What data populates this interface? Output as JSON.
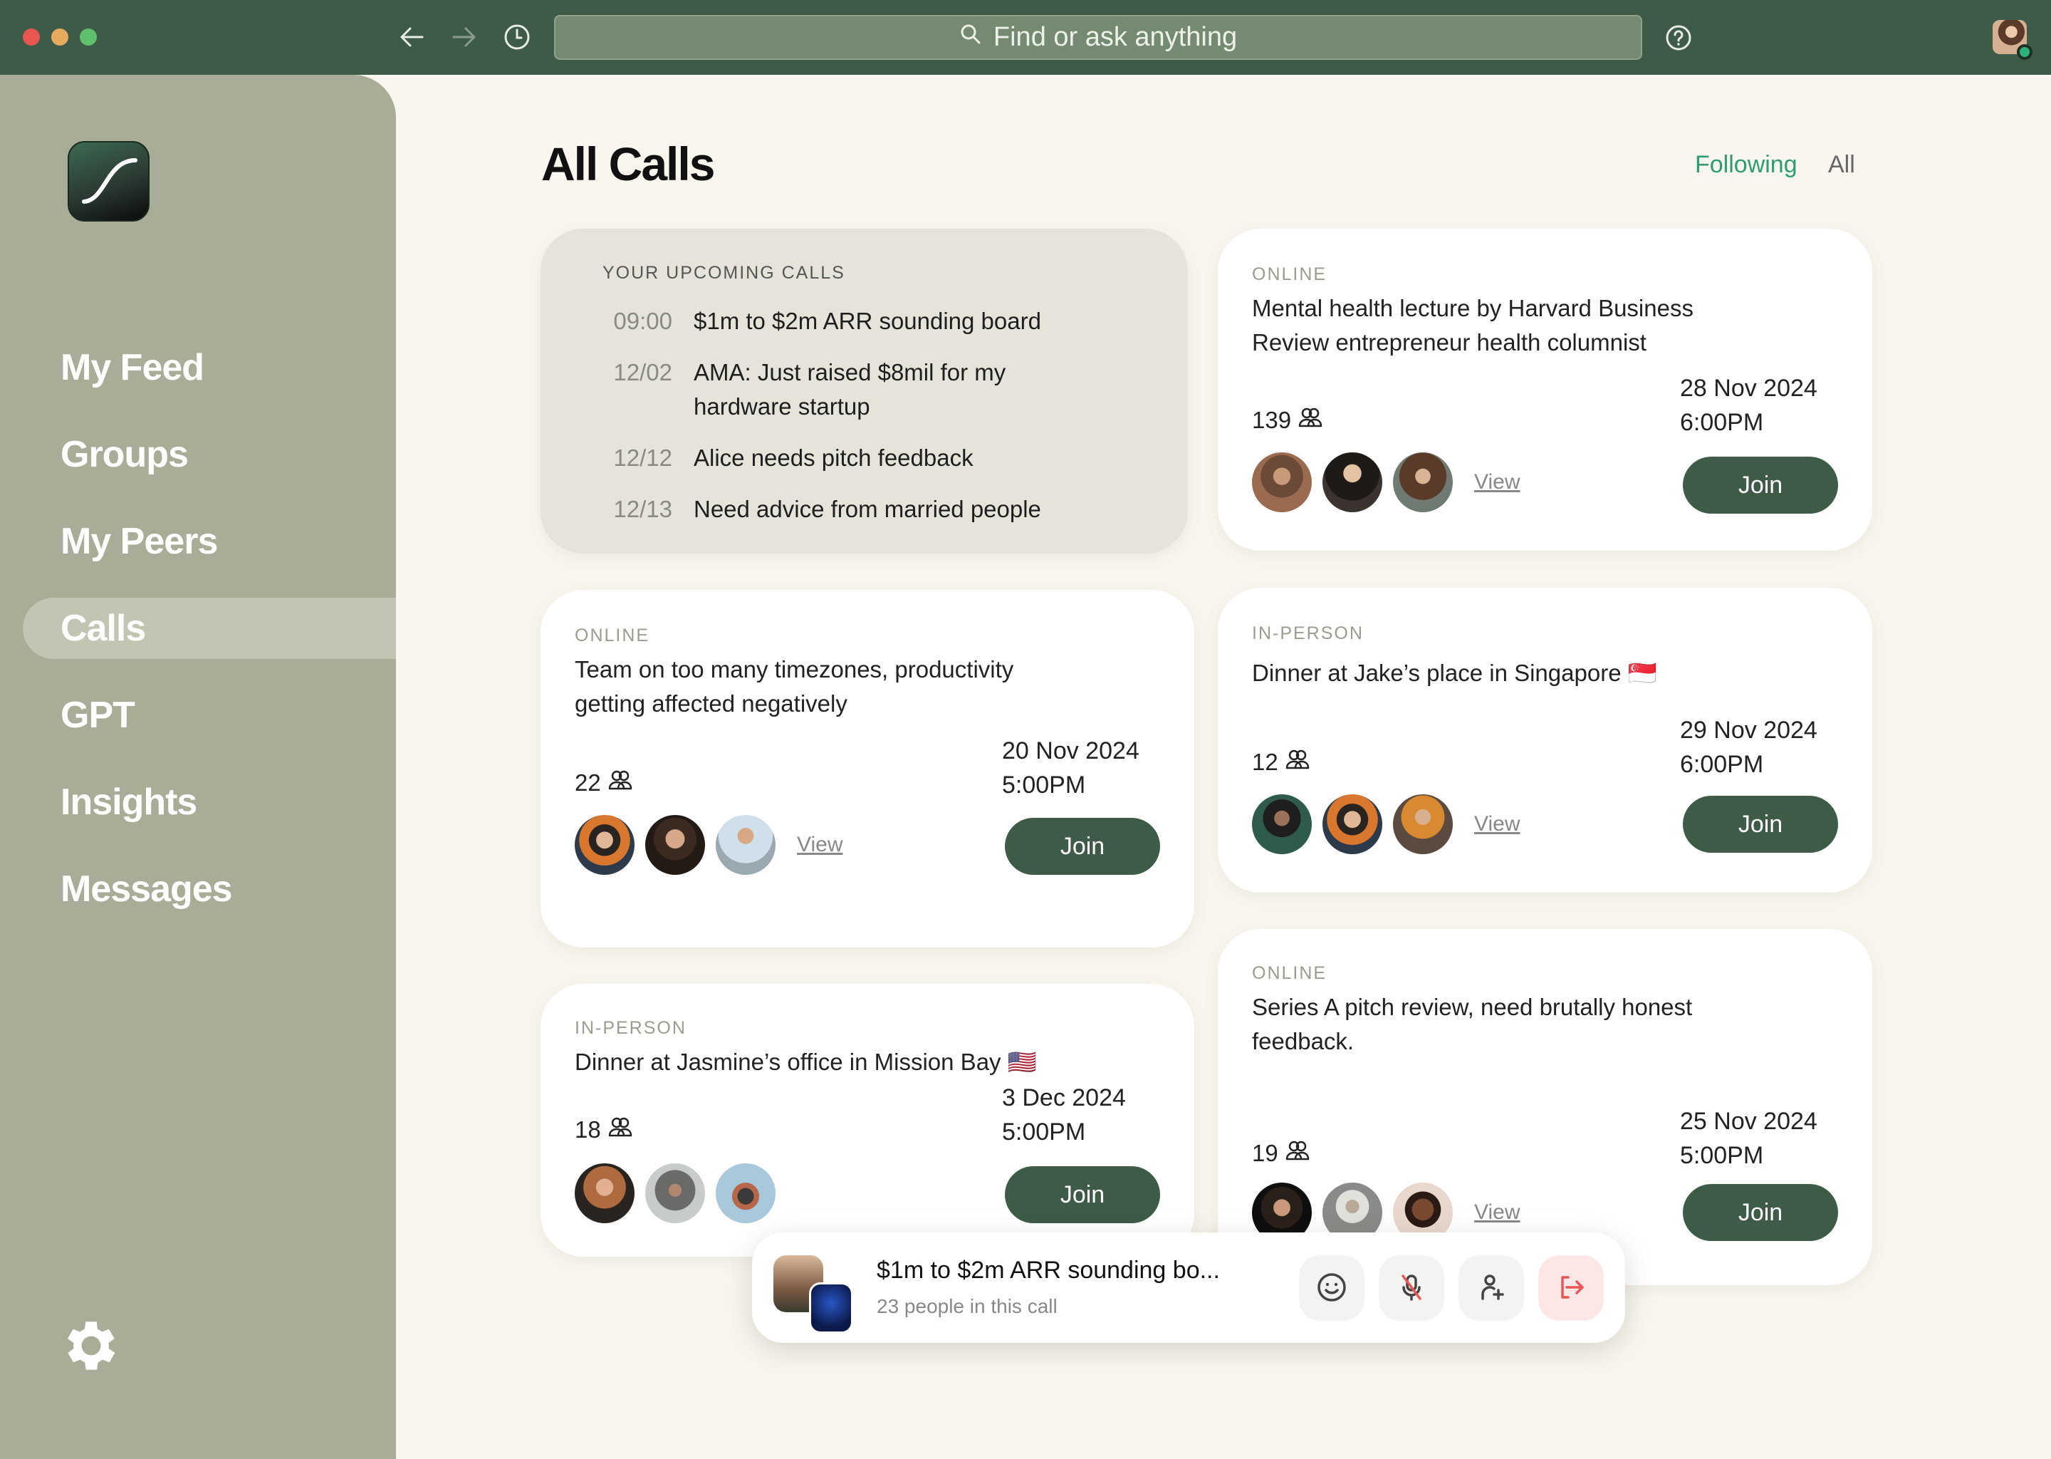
{
  "topbar": {
    "search_placeholder": "Find or ask anything",
    "icons": [
      "back-arrow-icon",
      "forward-arrow-icon",
      "history-clock-icon",
      "search-icon",
      "help-icon"
    ]
  },
  "sidebar": {
    "items": [
      {
        "label": "My Feed",
        "active": false
      },
      {
        "label": "Groups",
        "active": false
      },
      {
        "label": "My Peers",
        "active": false
      },
      {
        "label": "Calls",
        "active": true
      },
      {
        "label": "GPT",
        "active": false
      },
      {
        "label": "Insights",
        "active": false
      },
      {
        "label": "Messages",
        "active": false
      }
    ]
  },
  "main": {
    "title": "All Calls",
    "filters": {
      "following": "Following",
      "all": "All",
      "active": "Following"
    },
    "upcoming": {
      "heading": "YOUR UPCOMING CALLS",
      "items": [
        {
          "date": "09:00",
          "title": "$1m to $2m ARR sounding board"
        },
        {
          "date": "12/02",
          "title": "AMA: Just raised $8mil for my hardware startup"
        },
        {
          "date": "12/12",
          "title": "Alice needs pitch feedback"
        },
        {
          "date": "12/13",
          "title": "Need advice from married people"
        }
      ]
    },
    "cards": [
      {
        "type": "ONLINE",
        "title": "Mental health lecture by Harvard Business Review entrepreneur health columnist",
        "count": "139",
        "date": "28 Nov 2024",
        "time": "6:00PM",
        "view": "View",
        "join": "Join"
      },
      {
        "type": "ONLINE",
        "title": "Team on too many timezones, productivity getting affected negatively",
        "count": "22",
        "date": "20 Nov 2024",
        "time": "5:00PM",
        "view": "View",
        "join": "Join"
      },
      {
        "type": "IN-PERSON",
        "title": "Dinner at Jake’s place in Singapore 🇸🇬",
        "count": "12",
        "date": "29 Nov 2024",
        "time": "6:00PM",
        "view": "View",
        "join": "Join"
      },
      {
        "type": "IN-PERSON",
        "title": "Dinner at Jasmine’s office in Mission Bay 🇺🇸",
        "count": "18",
        "date": "3 Dec 2024",
        "time": "5:00PM",
        "view": "",
        "join": "Join"
      },
      {
        "type": "ONLINE",
        "title": "Series A pitch review, need brutally honest feedback.",
        "count": "19",
        "date": "25 Nov 2024",
        "time": "5:00PM",
        "view": "View",
        "join": "Join"
      }
    ]
  },
  "callbar": {
    "title": "$1m to $2m ARR sounding bo...",
    "subtitle": "23 people in this call",
    "buttons": [
      "emoji-reaction",
      "mute-microphone",
      "add-person",
      "leave-call"
    ]
  },
  "colors": {
    "topbar": "#3e5b48",
    "sidebar": "#a9ac97",
    "accent_green": "#2e9e6e",
    "join_button": "#3e5b48",
    "leave_red": "#e85555"
  }
}
